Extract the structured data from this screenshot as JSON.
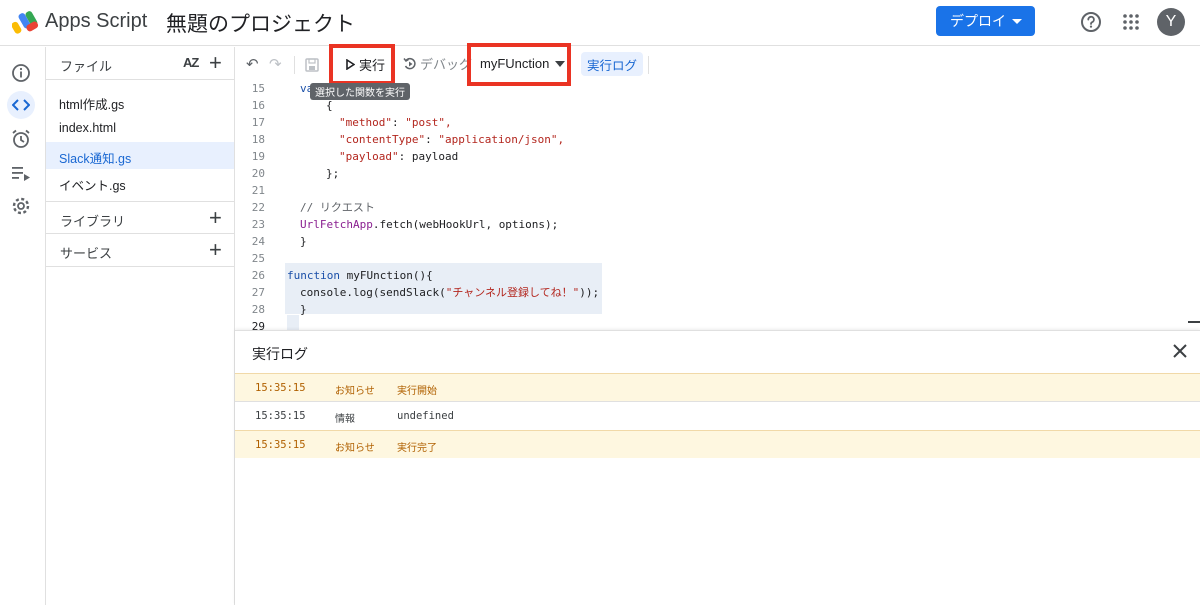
{
  "header": {
    "app_name": "Apps Script",
    "project_title": "無題のプロジェクト",
    "deploy_label": "デプロイ",
    "avatar_initial": "Y"
  },
  "files_panel": {
    "title": "ファイル",
    "sort_label": "AZ",
    "files": [
      {
        "name": "html作成.gs"
      },
      {
        "name": "index.html"
      },
      {
        "name": "Slack通知.gs",
        "active": true
      },
      {
        "name": "イベント.gs"
      }
    ],
    "libraries_label": "ライブラリ",
    "services_label": "サービス"
  },
  "toolbar": {
    "run_label": "実行",
    "debug_label": "デバッグ",
    "function_selected": "myFUnction",
    "log_label": "実行ログ",
    "run_tooltip": "選択した関数を実行"
  },
  "editor": {
    "current_line": 29,
    "lines": [
      {
        "n": "15",
        "text": "va"
      },
      {
        "n": "16",
        "text": "{"
      },
      {
        "n": "17",
        "key": "\"method\"",
        "val": "\"post\","
      },
      {
        "n": "18",
        "key": "\"contentType\"",
        "val": "\"application/json\","
      },
      {
        "n": "19",
        "key": "\"payload\"",
        "val": "payload"
      },
      {
        "n": "20",
        "text": "};"
      },
      {
        "n": "21",
        "text": ""
      },
      {
        "n": "22",
        "text": "// リクエスト"
      },
      {
        "n": "23",
        "obj": "UrlFetchApp",
        "rest": ".fetch(webHookUrl, options);"
      },
      {
        "n": "24",
        "text": "}"
      },
      {
        "n": "25",
        "text": ""
      },
      {
        "n": "26",
        "kw": "function",
        "rest": " myFUnction(){"
      },
      {
        "n": "27",
        "pre": "console.log(sendSlack(",
        "str": "\"チャンネル登録してね！\"",
        "post": "));"
      },
      {
        "n": "28",
        "text": "}"
      },
      {
        "n": "29",
        "text": ""
      }
    ]
  },
  "log_panel": {
    "title": "実行ログ",
    "entries": [
      {
        "time": "15:35:15",
        "level": "お知らせ",
        "message": "実行開始",
        "kind": "notice"
      },
      {
        "time": "15:35:15",
        "level": "情報",
        "message": "undefined",
        "kind": "info"
      },
      {
        "time": "15:35:15",
        "level": "お知らせ",
        "message": "実行完了",
        "kind": "notice"
      }
    ]
  },
  "colors": {
    "accent": "#1a73e8",
    "highlight": "#ea3323",
    "notice_bg": "#fef7e0",
    "notice_text": "#b06000"
  },
  "icons": {
    "rail": [
      "info-icon",
      "code-icon",
      "alarm-clock-icon",
      "executions-icon",
      "settings-gear-icon"
    ],
    "toolbar": [
      "undo-icon",
      "redo-icon",
      "save-icon",
      "play-icon",
      "debug-icon"
    ]
  }
}
